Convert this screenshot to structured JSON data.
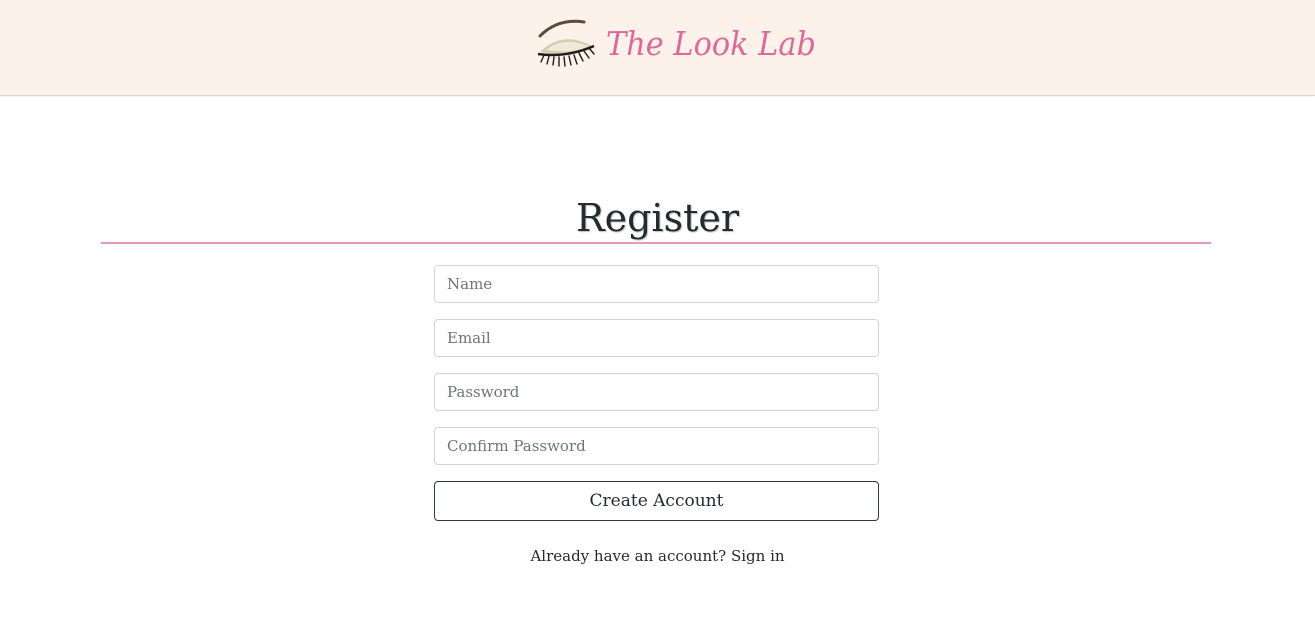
{
  "header": {
    "brand_name": "The Look Lab",
    "background": "#fdf2ea",
    "brand_color": "#e0679a",
    "logo_icon": "eye-lash-icon"
  },
  "main": {
    "title": "Register",
    "rule_color": "#e59ab5"
  },
  "form": {
    "name_placeholder": "Name",
    "email_placeholder": "Email",
    "password_placeholder": "Password",
    "confirm_placeholder": "Confirm Password",
    "submit_label": "Create Account"
  },
  "footer": {
    "prompt": "Already have an account?",
    "link_label": "Sign in"
  }
}
